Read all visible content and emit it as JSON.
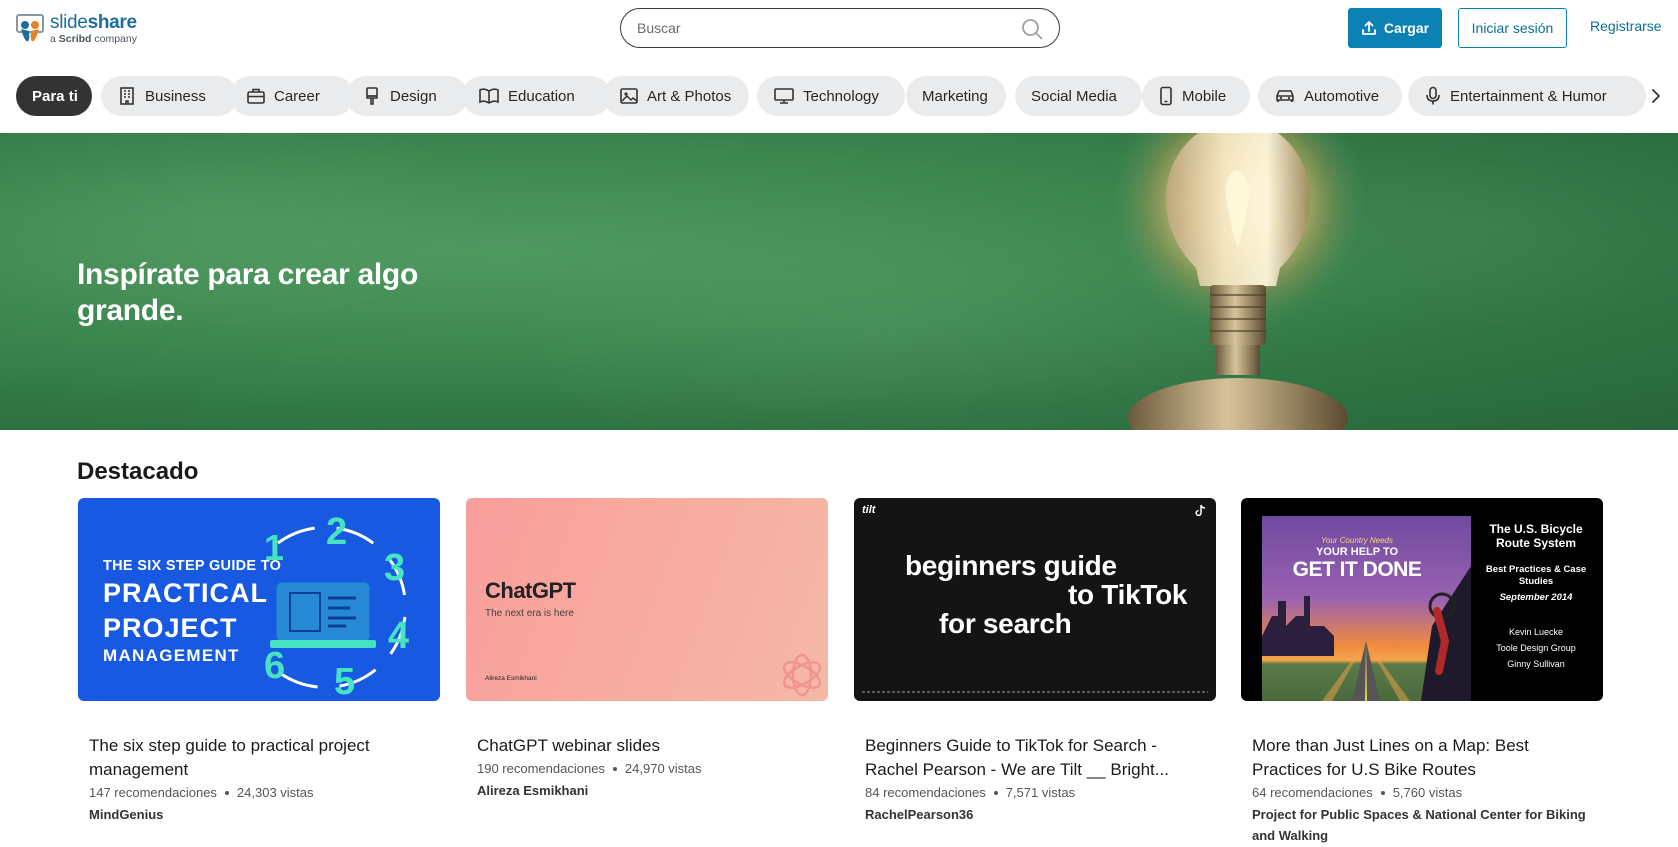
{
  "header": {
    "logo_name_light": "slide",
    "logo_name_bold": "share",
    "logo_sub_prefix": "a ",
    "logo_sub_brand": "Scribd",
    "logo_sub_suffix": " company",
    "search_placeholder": "Buscar",
    "upload_label": "Cargar",
    "login_label": "Iniciar sesión",
    "register_label": "Registrarse"
  },
  "categories": [
    {
      "label": "Para ti",
      "icon": "none",
      "active": true
    },
    {
      "label": "Business",
      "icon": "building-icon"
    },
    {
      "label": "Career",
      "icon": "briefcase-icon"
    },
    {
      "label": "Design",
      "icon": "paintbrush-icon"
    },
    {
      "label": "Education",
      "icon": "open-book-icon"
    },
    {
      "label": "Art & Photos",
      "icon": "image-icon"
    },
    {
      "label": "Technology",
      "icon": "monitor-icon"
    },
    {
      "label": "Marketing",
      "icon": "none"
    },
    {
      "label": "Social Media",
      "icon": "none"
    },
    {
      "label": "Mobile",
      "icon": "phone-icon"
    },
    {
      "label": "Automotive",
      "icon": "car-icon"
    },
    {
      "label": "Entertainment & Humor",
      "icon": "microphone-icon"
    }
  ],
  "hero": {
    "title": "Inspírate para crear algo grande."
  },
  "section": {
    "title": "Destacado"
  },
  "cards": [
    {
      "title": "The six step guide to practical project management",
      "recs": "147 recomendaciones",
      "views": "24,303 vistas",
      "author": "MindGenius",
      "thumb": {
        "line1": "THE SIX STEP GUIDE TO",
        "line2": "PRACTICAL",
        "line3": "PROJECT",
        "line4": "MANAGEMENT",
        "numbers": [
          "1",
          "2",
          "3",
          "4",
          "5",
          "6"
        ]
      }
    },
    {
      "title": "ChatGPT webinar slides",
      "recs": "190 recomendaciones",
      "views": "24,970 vistas",
      "author": "Alireza Esmikhani",
      "thumb": {
        "heading": "ChatGPT",
        "sub": "The next era is here",
        "author": "Alireza Esmikhani"
      }
    },
    {
      "title": "Beginners Guide to TikTok for Search - Rachel Pearson - We are Tilt __ Bright...",
      "recs": "84 recomendaciones",
      "views": "7,571 vistas",
      "author": "RachelPearson36",
      "thumb": {
        "line1": "beginners guide",
        "line2": "to TikTok",
        "line3": "for search",
        "brand": "tilt"
      }
    },
    {
      "title": "More than Just Lines on a Map: Best Practices for U.S Bike Routes",
      "recs": "64 recomendaciones",
      "views": "5,760 vistas",
      "author": "Project for Public Spaces & National Center for Biking and Walking",
      "thumb": {
        "poster_top": "Your Country Needs",
        "poster_mid": "YOUR HELP TO",
        "poster_big": "GET IT DONE",
        "side_title": "The U.S. Bicycle Route System",
        "side_sub": "Best Practices & Case Studies",
        "side_date": "September 2014",
        "side_names": [
          "Kevin Luecke",
          "Toole Design Group",
          "Ginny Sullivan"
        ]
      }
    }
  ],
  "colors": {
    "brand_blue": "#0b82b3",
    "hero_green": "#3f8a52",
    "chip_bg": "#e9ebed",
    "chip_active_bg": "#333333"
  }
}
